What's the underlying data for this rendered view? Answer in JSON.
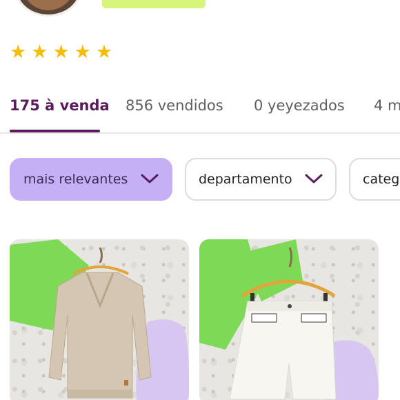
{
  "profile": {
    "rating_stars": 5,
    "stars": [
      "★",
      "★",
      "★",
      "★",
      "★"
    ]
  },
  "tabs": [
    {
      "label": "175 à venda",
      "active": true
    },
    {
      "label": "856 vendidos",
      "active": false
    },
    {
      "label": "0 yeyezados",
      "active": false
    },
    {
      "label": "4 m",
      "active": false
    }
  ],
  "filters": [
    {
      "label": "mais relevantes",
      "active": true
    },
    {
      "label": "departamento",
      "active": false
    },
    {
      "label": "categ",
      "active": false
    }
  ],
  "products": [
    {
      "icon": "beige-v-neck-sweater"
    },
    {
      "icon": "white-shorts"
    }
  ],
  "colors": {
    "accent": "#5b1c5e",
    "filter_active": "#c6b0f5",
    "star": "#f5bd08",
    "badge": "#d6f57a"
  }
}
